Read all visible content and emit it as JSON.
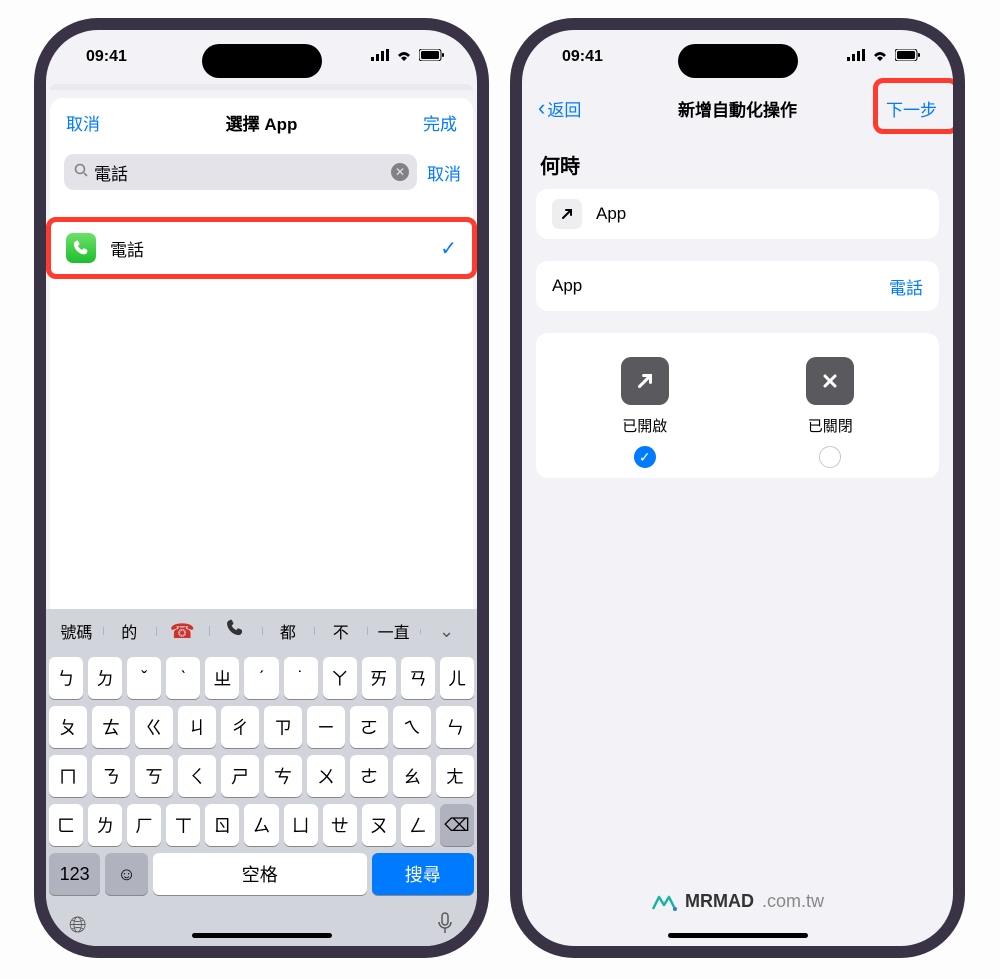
{
  "status": {
    "time": "09:41"
  },
  "left": {
    "nav": {
      "cancel": "取消",
      "title": "選擇 App",
      "done": "完成"
    },
    "search": {
      "value": "電話",
      "cancel": "取消"
    },
    "app": {
      "name": "電話"
    },
    "suggestions": [
      "號碼",
      "的",
      "☎",
      "📞",
      "都",
      "不",
      "一直"
    ],
    "kb": {
      "rows": [
        [
          "ㄅ",
          "ㄉ",
          "ˇ",
          "ˋ",
          "ㄓ",
          "ˊ",
          "˙",
          "ㄚ",
          "ㄞ",
          "ㄢ",
          "ㄦ"
        ],
        [
          "ㄆ",
          "ㄊ",
          "ㄍ",
          "ㄐ",
          "ㄔ",
          "ㄗ",
          "ㄧ",
          "ㄛ",
          "ㄟ",
          "ㄣ"
        ],
        [
          "ㄇ",
          "ㄋ",
          "ㄎ",
          "ㄑ",
          "ㄕ",
          "ㄘ",
          "ㄨ",
          "ㄜ",
          "ㄠ",
          "ㄤ"
        ],
        [
          "ㄈ",
          "ㄌ",
          "ㄏ",
          "ㄒ",
          "ㄖ",
          "ㄙ",
          "ㄩ",
          "ㄝ",
          "ㄡ",
          "ㄥ"
        ]
      ],
      "num": "123",
      "space": "空格",
      "search": "搜尋"
    }
  },
  "right": {
    "nav": {
      "back": "返回",
      "title": "新增自動化操作",
      "next": "下一步"
    },
    "section": "何時",
    "trigger": {
      "label": "App"
    },
    "app_row": {
      "label": "App",
      "value": "電話"
    },
    "toggles": {
      "opened": {
        "label": "已開啟",
        "selected": true
      },
      "closed": {
        "label": "已關閉",
        "selected": false
      }
    }
  },
  "watermark": {
    "brand": "MRMAD",
    "domain": ".com.tw"
  }
}
